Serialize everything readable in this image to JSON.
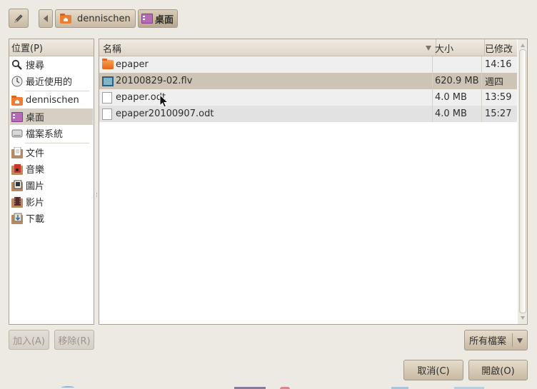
{
  "toolbar": {
    "path_segments": [
      {
        "label": "dennischen",
        "icon": "home-folder-icon"
      },
      {
        "label": "桌面",
        "icon": "desktop-icon"
      }
    ]
  },
  "places": {
    "header": "位置(P)",
    "items": [
      {
        "label": "搜尋",
        "icon": "search-icon"
      },
      {
        "label": "最近使用的",
        "icon": "recent-icon"
      },
      {
        "label": "dennischen",
        "icon": "home-folder-icon"
      },
      {
        "label": "桌面",
        "icon": "desktop-icon",
        "selected": true
      },
      {
        "label": "檔案系統",
        "icon": "drive-icon"
      },
      {
        "label": "文件",
        "icon": "documents-folder-icon"
      },
      {
        "label": "音樂",
        "icon": "music-folder-icon"
      },
      {
        "label": "圖片",
        "icon": "pictures-folder-icon"
      },
      {
        "label": "影片",
        "icon": "videos-folder-icon"
      },
      {
        "label": "下載",
        "icon": "downloads-folder-icon"
      }
    ],
    "add_button": "加入(A)",
    "remove_button": "移除(R)"
  },
  "files": {
    "columns": {
      "name": "名稱",
      "size": "大小",
      "modified": "已修改"
    },
    "rows": [
      {
        "name": "epaper",
        "size": "",
        "modified": "14:16",
        "icon": "folder-icon"
      },
      {
        "name": "20100829-02.flv",
        "size": "620.9 MB",
        "modified": "週四",
        "icon": "video-file-icon",
        "selected": true
      },
      {
        "name": "epaper.odt",
        "size": "4.0 MB",
        "modified": "13:59",
        "icon": "document-icon"
      },
      {
        "name": "epaper20100907.odt",
        "size": "4.0 MB",
        "modified": "15:27",
        "icon": "document-icon"
      }
    ]
  },
  "filter": {
    "selected": "所有檔案"
  },
  "actions": {
    "cancel": "取消(C)",
    "open": "開啟(O)"
  },
  "colors": {
    "selection": "#cdc4b5",
    "row_alt": "#e2e2e2",
    "header": "#e9e2d5"
  }
}
